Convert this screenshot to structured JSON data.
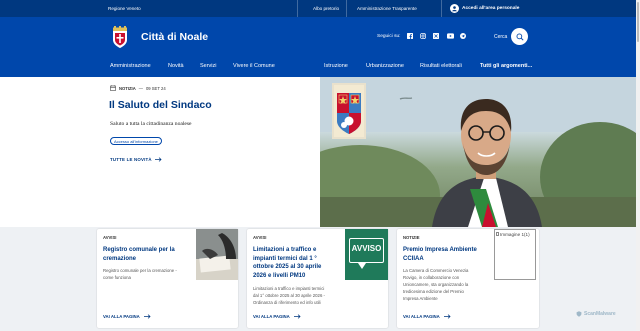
{
  "topbar": {
    "region": "Regione Veneto",
    "links": [
      "Albo pretorio",
      "Amministrazione Trasparente"
    ],
    "login": "Accedi all'area personale"
  },
  "header": {
    "site_title": "Città di Noale",
    "follow_label": "Seguici su:",
    "social_icons": [
      "facebook-icon",
      "instagram-icon",
      "x-icon",
      "youtube-icon",
      "telegram-icon"
    ],
    "search_label": "Cerca"
  },
  "nav": {
    "main": [
      "Amministrazione",
      "Novità",
      "Servizi",
      "Vivere il Comune"
    ],
    "secondary": [
      "Istruzione",
      "Urbanizzazione",
      "Risultati elettorali"
    ],
    "all_topics": "Tutti gli argomenti..."
  },
  "hero": {
    "tag": "NOTIZIA",
    "dash": "—",
    "date": "09 SET 24",
    "title": "Il Saluto del Sindaco",
    "subtitle": "Saluto a tutta la cittadinanza noalese",
    "chip": "Accesso all'informazione",
    "link": "TUTTE LE NOVITÀ"
  },
  "cards": [
    {
      "category": "AVVISI",
      "title_lines": [
        "Registro comunale per la",
        "cremazione"
      ],
      "desc_lines": [
        "Registro comunale per la cremazione -",
        "come funziona"
      ],
      "more": "VAI ALLA PAGINA"
    },
    {
      "category": "AVVISI",
      "title_lines": [
        "Limitazioni a traffico e",
        "impianti termici dal 1 °",
        "ottobre 2025 al 30 aprile",
        "2026 e livelli PM10"
      ],
      "desc_lines": [
        "Limitazioni a traffico e impianti termici",
        "dal 1° ottobre 2025 al 30 aprile 2026 -",
        "Ordinanza di riferimento ed info utili"
      ],
      "image_text": "AVVISO",
      "more": "VAI ALLA PAGINA"
    },
    {
      "category": "NOTIZIE",
      "title_lines": [
        "Premio Impresa Ambiente",
        "CCIIAA"
      ],
      "desc_lines": [
        "La Camera di Commercio Venezia",
        "Rovigo, in collaborazione con",
        "Unioncamere, sta organizzando la",
        "tredicesima edizione del Premio",
        "Impresa Ambiente"
      ],
      "broken_image_alt": "Immagine 1(1)",
      "more": "VAI ALLA PAGINA"
    }
  ],
  "watermark": "ScanMalware",
  "colors": {
    "topbar": "#003880",
    "header": "#0047ab",
    "accent": "#003880",
    "cards_bg": "#eef1f4",
    "avviso_green": "#1f7a5a"
  }
}
